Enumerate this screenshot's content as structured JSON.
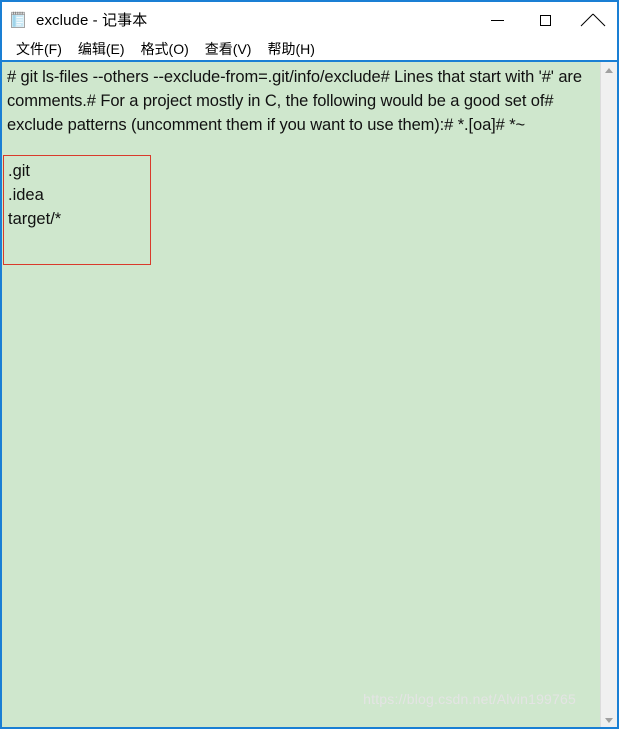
{
  "window": {
    "title": "exclude - 记事本",
    "app_icon": "notepad-icon",
    "border_color": "#1a7fd4",
    "controls": {
      "minimize": "—",
      "maximize": "□",
      "close": "✕"
    }
  },
  "menubar": {
    "items": [
      {
        "label": "文件(F)"
      },
      {
        "label": "编辑(E)"
      },
      {
        "label": "格式(O)"
      },
      {
        "label": "查看(V)"
      },
      {
        "label": "帮助(H)"
      }
    ]
  },
  "editor": {
    "background_color": "#cfe7cd",
    "text_color": "#111111",
    "wrapped_text": "# git ls-files --others --exclude-from=.git/info/exclude# Lines that start with '#' are comments.# For a project mostly in C, the following would be a good set of# exclude patterns (uncomment them if you want to use them):# *.[oa]# *~",
    "highlight_box": {
      "border_color": "#d93a2b",
      "lines": [
        ".git",
        ".idea",
        "target/*"
      ]
    },
    "watermark": "https://blog.csdn.net/Alvin199765"
  },
  "scrollbar": {
    "up_arrow": "scroll-up-arrow",
    "down_arrow": "scroll-down-arrow",
    "track_color": "#f0f0f0"
  }
}
